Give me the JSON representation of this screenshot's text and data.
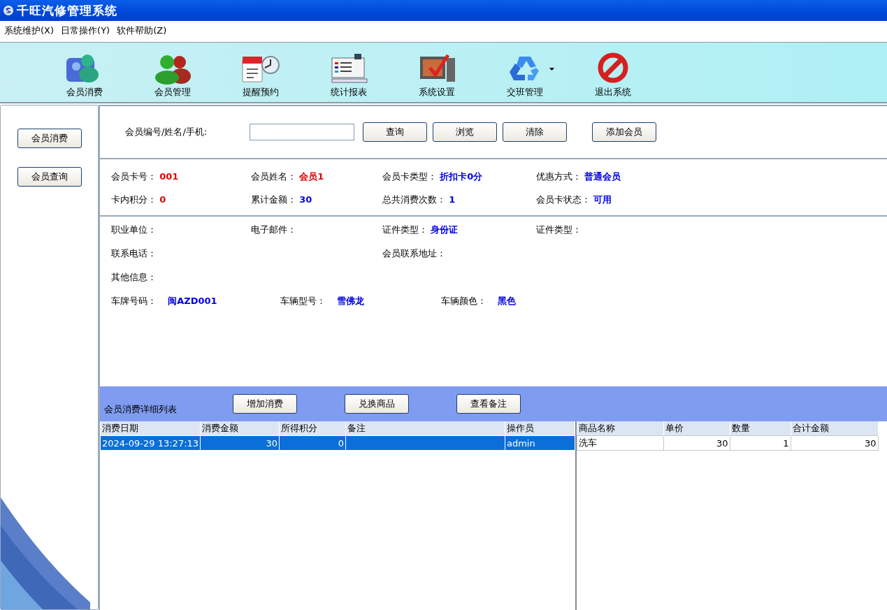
{
  "window": {
    "title": "千旺汽修管理系统"
  },
  "menu": [
    "系统维护(X)",
    "日常操作(Y)",
    "软件帮助(Z)"
  ],
  "toolbar": [
    {
      "label": "会员消费",
      "has_menu": false
    },
    {
      "label": "会员管理",
      "has_menu": false
    },
    {
      "label": "提醒预约",
      "has_menu": false
    },
    {
      "label": "统计报表",
      "has_menu": false
    },
    {
      "label": "系统设置",
      "has_menu": false
    },
    {
      "label": "交班管理",
      "has_menu": true
    },
    {
      "label": "退出系统",
      "has_menu": false
    }
  ],
  "sidebar": {
    "buttons": [
      "会员消费",
      "会员查询"
    ]
  },
  "search": {
    "label": "会员编号/姓名/手机:",
    "buttons": [
      "查询",
      "浏览",
      "清除"
    ],
    "add_button": "添加会员"
  },
  "card_info": [
    [
      {
        "label": "会员卡号：",
        "value": "001",
        "color": "#e00000"
      },
      {
        "label": "会员姓名：",
        "value": "会员1",
        "color": "#e00000"
      },
      {
        "label": "会员卡类型：",
        "value": "折扣卡0分",
        "color": "#0000e0"
      },
      {
        "label": "优惠方式：",
        "value": "普通会员",
        "color": "#0000e0"
      }
    ],
    [
      {
        "label": "卡内积分：",
        "value": "0",
        "color": "#e00000"
      },
      {
        "label": "累计金额：",
        "value": "30",
        "color": "#0000e0"
      },
      {
        "label": "总共消费次数：",
        "value": "1",
        "color": "#0000e0"
      },
      {
        "label": "会员卡状态：",
        "value": "可用",
        "color": "#0000e0"
      }
    ]
  ],
  "details": [
    [
      {
        "label": "职业单位："
      },
      {
        "label": "电子邮件："
      },
      {
        "label": "证件类型：",
        "value": "身份证"
      },
      {
        "label": "证件类型："
      }
    ],
    [
      {
        "label": "联系电话："
      },
      {
        "label": "会员联系地址："
      }
    ],
    [
      {
        "label": "其他信息："
      }
    ]
  ],
  "vehicle": [
    {
      "label": "车牌号码：",
      "value": "闽AZD001"
    },
    {
      "label": "车辆型号：",
      "value": "雪佛龙"
    },
    {
      "label": "车辆颜色：",
      "value": "黑色"
    }
  ],
  "records_bar": {
    "title": "会员消费详细列表",
    "buttons": [
      "增加消费",
      "兑换商品",
      "查看备注"
    ]
  },
  "records": {
    "columns": [
      "消费日期",
      "消费金额",
      "所得积分",
      "备注",
      "操作员"
    ],
    "rows": [
      {
        "cells": [
          "2024-09-29 13:27:13",
          "30",
          "0",
          "",
          "admin"
        ],
        "selected": true
      }
    ]
  },
  "items": {
    "columns": [
      "商品名称",
      "单价",
      "数量",
      "合计金额"
    ],
    "rows": [
      {
        "cells": [
          "洗车",
          "30",
          "1",
          "30"
        ],
        "selected": false
      }
    ]
  }
}
